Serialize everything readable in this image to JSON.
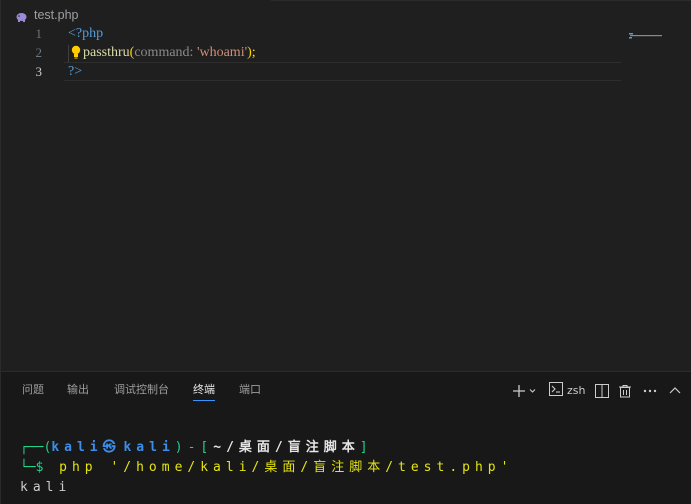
{
  "editor": {
    "tab": {
      "filename": "test.php",
      "icon": "php-elephant-icon"
    },
    "lines": [
      {
        "number": "1",
        "open_tag": "<?php"
      },
      {
        "number": "2",
        "function": "passthru",
        "open_paren": "(",
        "param_hint": "command:",
        "argument": "'whoami'",
        "close": ");"
      },
      {
        "number": "3",
        "close_tag": "?>"
      }
    ],
    "active_line": "3"
  },
  "panel": {
    "tabs": [
      {
        "label": "问题"
      },
      {
        "label": "输出"
      },
      {
        "label": "调试控制台"
      },
      {
        "label": "终端",
        "active": true
      },
      {
        "label": "端口"
      }
    ],
    "actions": {
      "add": "add-terminal-icon",
      "profile_label": "zsh",
      "split": "split-terminal-icon",
      "kill": "trash-icon",
      "more": "more-icon",
      "maximize": "chevron-up-icon"
    }
  },
  "terminal": {
    "prompt": {
      "corner_top": "┌──(",
      "user": "kali",
      "at": "㉿",
      "host": "kali",
      "sep": ")-[",
      "path": "~/桌面/盲注脚本",
      "end": "]",
      "corner_bottom": "└─$"
    },
    "command": "php '/home/kali/桌面/盲注脚本/test.php'",
    "output": "kali"
  },
  "colors": {
    "editor_bg": "#1f1f1f",
    "panel_bg": "#181818",
    "accent": "#3794ff",
    "prompt_green": "#23d18b",
    "prompt_blue": "#3b8eea",
    "command_yellow": "#e5e510"
  }
}
